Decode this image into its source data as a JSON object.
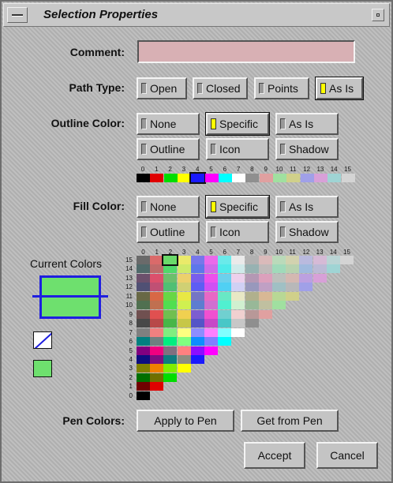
{
  "window": {
    "title": "Selection Properties"
  },
  "comment": {
    "label": "Comment:",
    "value": ""
  },
  "path_type": {
    "label": "Path Type:",
    "options": [
      "Open",
      "Closed",
      "Points",
      "As Is"
    ],
    "selected": "As Is"
  },
  "outline_color": {
    "label": "Outline Color:",
    "options": [
      "None",
      "Specific",
      "As Is",
      "Outline",
      "Icon",
      "Shadow"
    ],
    "selected": "Specific"
  },
  "fill_color": {
    "label": "Fill Color:",
    "options": [
      "None",
      "Specific",
      "As Is",
      "Outline",
      "Icon",
      "Shadow"
    ],
    "selected": "Specific"
  },
  "palette": {
    "indices": [
      "0",
      "1",
      "2",
      "3",
      "4",
      "5",
      "6",
      "7",
      "8",
      "9",
      "10",
      "11",
      "12",
      "13",
      "14",
      "15"
    ],
    "colors": [
      "#000000",
      "#e00000",
      "#00dd00",
      "#ffff00",
      "#1a1aff",
      "#ff00ff",
      "#00ffff",
      "#ffffff",
      "#8f8f8f",
      "#e0a0a0",
      "#a0e0a0",
      "#d0d08a",
      "#a0a0e8",
      "#d8a0d8",
      "#9fd4d4",
      "#d4d4d4"
    ],
    "selected_outline_index": 4
  },
  "current_colors": {
    "label": "Current Colors",
    "fill": "#6ee06e",
    "outline": "#1f1fe0"
  },
  "grid": {
    "selected_row": 15,
    "selected_col": 2
  },
  "pen_colors": {
    "label": "Pen Colors:",
    "apply_label": "Apply to Pen",
    "get_label": "Get from Pen"
  },
  "actions": {
    "accept_label": "Accept",
    "cancel_label": "Cancel"
  }
}
